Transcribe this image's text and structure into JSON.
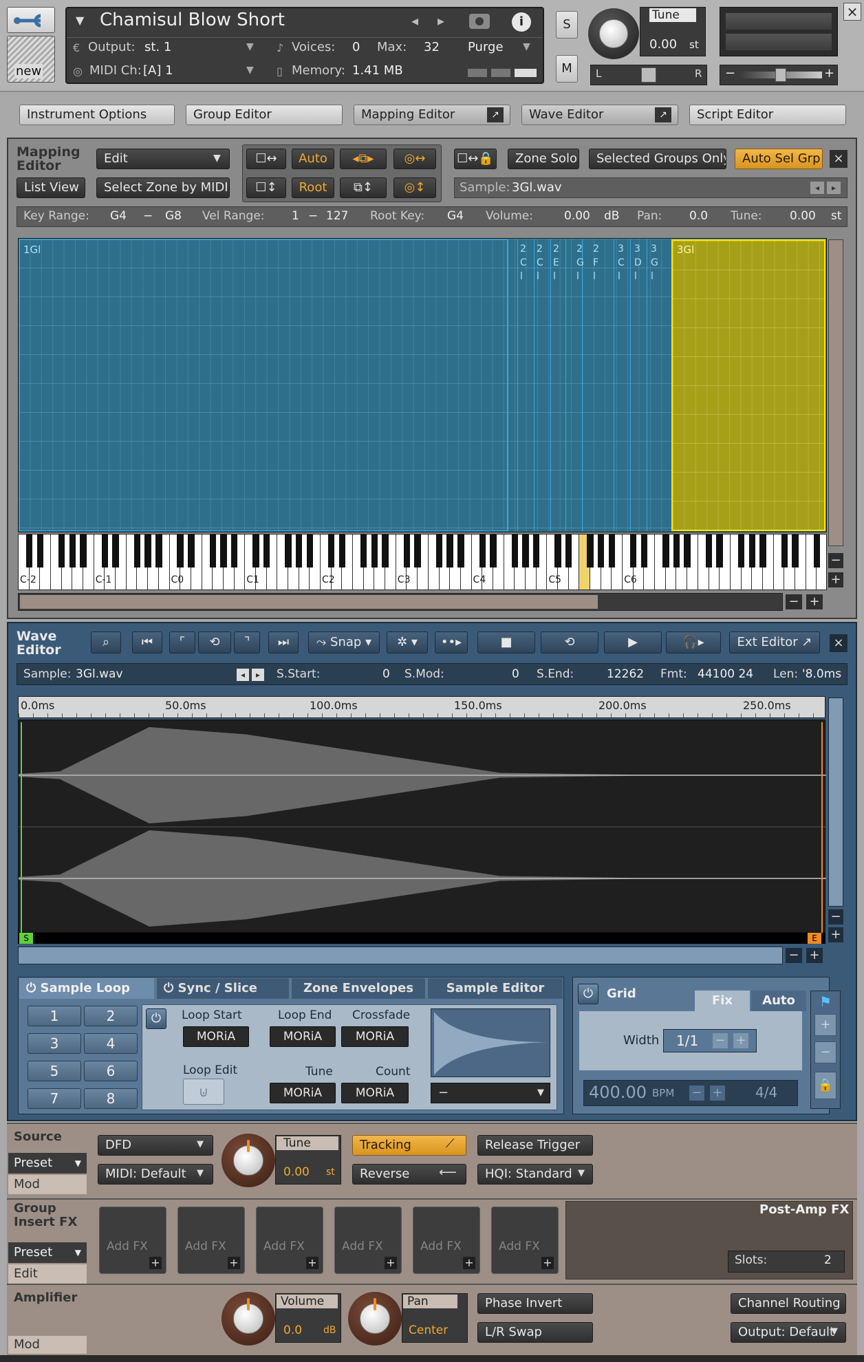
{
  "header": {
    "instrument_name": "Chamisul Blow Short",
    "output_label": "Output:",
    "output_value": "st. 1",
    "voices_label": "Voices:",
    "voices_value": "0",
    "max_label": "Max:",
    "max_value": "32",
    "purge_label": "Purge",
    "midi_label": "MIDI Ch:",
    "midi_value": "[A]  1",
    "memory_label": "Memory:",
    "memory_value": "1.41 MB",
    "new_label": "new",
    "s_label": "S",
    "m_label": "M",
    "tune_label": "Tune",
    "tune_value": "0.00",
    "tune_unit": "st",
    "pan_l": "L",
    "pan_r": "R",
    "vol_minus": "−",
    "vol_plus": "+",
    "close_label": "×"
  },
  "tabs": [
    "Instrument Options",
    "Group Editor",
    "Mapping Editor",
    "Wave Editor",
    "Script Editor"
  ],
  "mapping": {
    "title1": "Mapping",
    "title2": "Editor",
    "edit_menu": "Edit",
    "list_view": "List View",
    "select_zone": "Select Zone by MIDI",
    "auto": "Auto",
    "root": "Root",
    "zone_solo": "Zone Solo",
    "selected_groups_only": "Selected Groups Only",
    "auto_sel_grp": "Auto Sel Grp",
    "sample_label": "Sample:",
    "sample_value": "3Gl.wav",
    "key_range_label": "Key Range:",
    "key_lo": "G4",
    "dash": "−",
    "key_hi": "G8",
    "vel_range_label": "Vel Range:",
    "vel_lo": "1",
    "vel_hi": "127",
    "root_key_label": "Root Key:",
    "root_key_value": "G4",
    "volume_label": "Volume:",
    "volume_value": "0.00",
    "volume_unit": "dB",
    "pan_label": "Pan:",
    "pan_value": "0.0",
    "tune_label": "Tune:",
    "tune_value": "0.00",
    "tune_unit": "st",
    "zone_big": "1Gl",
    "zone_sel": "3Gl",
    "narrow_zones": [
      [
        "2",
        "C",
        "l"
      ],
      [
        "2",
        "C",
        "l"
      ],
      [
        "2",
        "E",
        "l"
      ],
      [
        "2",
        "G",
        "l"
      ],
      [
        "2",
        "F",
        "l"
      ],
      [
        "3",
        "C",
        "l"
      ],
      [
        "3",
        "D",
        "l"
      ],
      [
        "3",
        "G",
        "l"
      ]
    ],
    "octave_labels": [
      "C-2",
      "C-1",
      "C0",
      "C1",
      "C2",
      "C3",
      "C4",
      "C5",
      "C6"
    ]
  },
  "wave": {
    "title1": "Wave",
    "title2": "Editor",
    "snap": "Snap",
    "ext_editor": "Ext Editor",
    "sample_label": "Sample:",
    "sample_value": "3Gl.wav",
    "sstart_label": "S.Start:",
    "sstart_value": "0",
    "smod_label": "S.Mod:",
    "smod_value": "0",
    "send_label": "S.End:",
    "send_value": "12262",
    "fmt_label": "Fmt:",
    "fmt_value": "44100  24",
    "len_label": "Len:",
    "len_value": "'8.0ms",
    "ruler": [
      "0.0ms",
      "50.0ms",
      "100.0ms",
      "150.0ms",
      "200.0ms",
      "250.0ms"
    ],
    "start_marker": "S",
    "end_marker": "E"
  },
  "loop": {
    "tabs": [
      "Sample Loop",
      "Sync / Slice",
      "Zone Envelopes",
      "Sample Editor"
    ],
    "numbers": [
      "1",
      "2",
      "3",
      "4",
      "5",
      "6",
      "7",
      "8"
    ],
    "loop_start": "Loop Start",
    "loop_end": "Loop End",
    "crossfade": "Crossfade",
    "loop_edit": "Loop Edit",
    "tune": "Tune",
    "count": "Count",
    "moria": "MORiA",
    "mode_select": "−"
  },
  "grid": {
    "title": "Grid",
    "fix": "Fix",
    "auto": "Auto",
    "width_label": "Width",
    "width_value": "1/1",
    "bpm_value": "400.00",
    "bpm_unit": "BPM",
    "signature": "4/4"
  },
  "source": {
    "title": "Source",
    "preset": "Preset",
    "mod": "Mod",
    "engine": "DFD",
    "midi_default": "MIDI: Default",
    "tune_label": "Tune",
    "tune_value": "0.00",
    "tune_unit": "st",
    "tracking": "Tracking",
    "reverse": "Reverse",
    "release_trigger": "Release Trigger",
    "hqi": "HQI: Standard"
  },
  "insert_fx": {
    "title1": "Group",
    "title2": "Insert FX",
    "preset": "Preset",
    "edit": "Edit",
    "add_fx": "Add FX",
    "post_amp_title": "Post-Amp FX",
    "slots_label": "Slots:",
    "slots_value": "2"
  },
  "amplifier": {
    "title": "Amplifier",
    "mod": "Mod",
    "volume_label": "Volume",
    "volume_value": "0.0",
    "volume_unit": "dB",
    "pan_label": "Pan",
    "pan_value": "Center",
    "phase_invert": "Phase Invert",
    "lr_swap": "L/R Swap",
    "channel_routing": "Channel Routing",
    "output": "Output: Default"
  },
  "colors": {
    "zone_blue": "#2e6f8c",
    "zone_selected": "#a69f18",
    "selected_border": "#ffe600",
    "accent_orange": "#f0a830",
    "panel_blue": "#3a5a78"
  }
}
